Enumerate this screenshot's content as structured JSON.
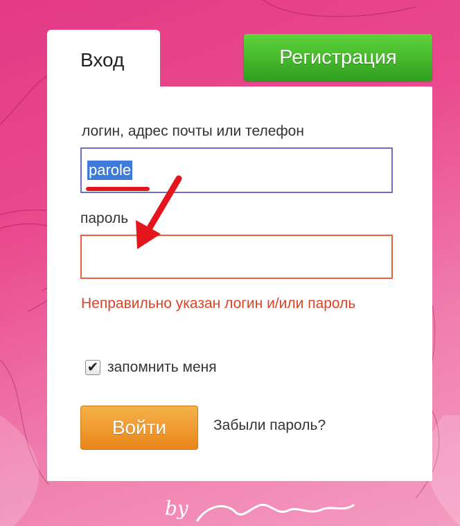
{
  "tabs": {
    "login_label": "Вход",
    "register_label": "Регистрация"
  },
  "form": {
    "login_label": "логин, адрес почты или телефон",
    "login_value": "parole",
    "password_label": "пароль",
    "password_value": "",
    "error_message": "Неправильно указан логин и/или пароль",
    "remember_label": "запомнить меня",
    "remember_checked": true,
    "submit_label": "Войти",
    "forgot_label": "Забыли пароль?"
  },
  "footer": {
    "by_label": "by"
  },
  "colors": {
    "background": "#e33a86",
    "register_button": "#3fb526",
    "login_button": "#ee951f",
    "error_text": "#d94325",
    "annotation_arrow": "#e4161c"
  },
  "icons": {
    "checkbox": "check-icon",
    "annotation": "red-arrow-icon"
  }
}
